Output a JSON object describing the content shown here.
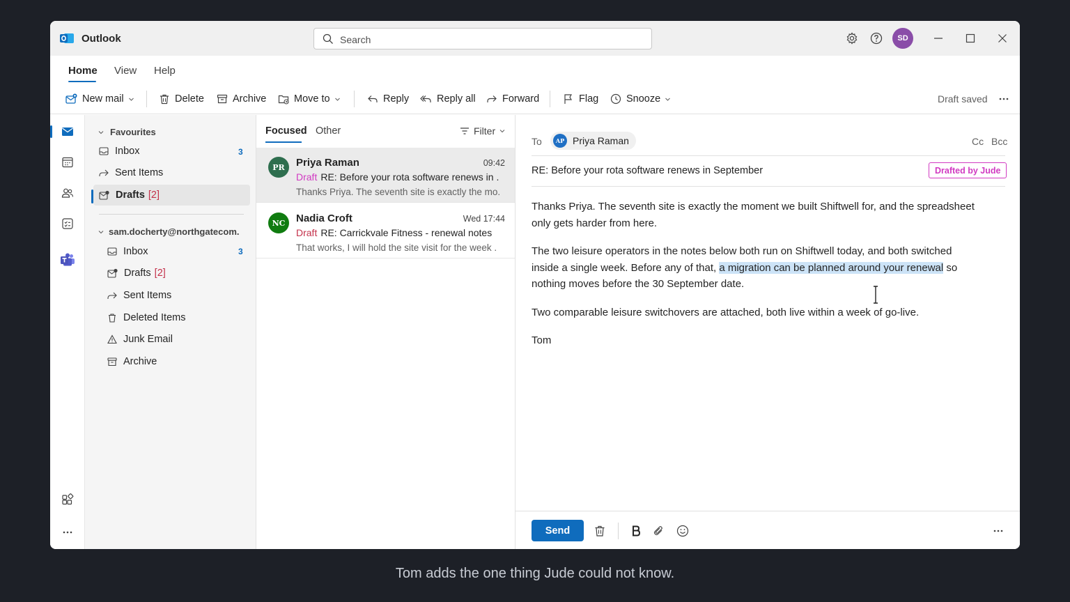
{
  "app": {
    "name": "Outlook"
  },
  "search": {
    "placeholder": "Search"
  },
  "titlebar": {
    "avatar_initials": "SD"
  },
  "ribbon_tabs": [
    "Home",
    "View",
    "Help"
  ],
  "ribbon": {
    "new_mail": "New mail",
    "delete": "Delete",
    "archive": "Archive",
    "move_to": "Move to",
    "reply": "Reply",
    "reply_all": "Reply all",
    "forward": "Forward",
    "flag": "Flag",
    "snooze": "Snooze",
    "status": "Draft saved"
  },
  "folders": {
    "favourites_label": "Favourites",
    "favourites": [
      {
        "label": "Inbox",
        "count": "3"
      },
      {
        "label": "Sent Items"
      },
      {
        "label": "Drafts",
        "count": "[2]"
      }
    ],
    "account_label": "sam.docherty@northgatecom.",
    "account": [
      {
        "label": "Inbox",
        "count": "3"
      },
      {
        "label": "Drafts",
        "count": "[2]"
      },
      {
        "label": "Sent Items"
      },
      {
        "label": "Deleted Items"
      },
      {
        "label": "Junk Email"
      },
      {
        "label": "Archive"
      }
    ]
  },
  "list": {
    "tabs": [
      "Focused",
      "Other"
    ],
    "filter": "Filter",
    "messages": [
      {
        "initials": "PR",
        "sender": "Priya Raman",
        "time": "09:42",
        "draft": "Draft",
        "subject": "RE: Before your rota software renews in .",
        "preview": "Thanks Priya. The seventh site is exactly the mo.",
        "avatar_color": "#2e6e4e"
      },
      {
        "initials": "NC",
        "sender": "Nadia Croft",
        "time": "Wed 17:44",
        "draft": "Draft",
        "subject": "RE: Carrickvale Fitness - renewal notes",
        "preview": "That works, I will hold the site visit for the week .",
        "avatar_color": "#107c10"
      }
    ]
  },
  "reading": {
    "to_label": "To",
    "recipient_initials": "AP",
    "recipient": "Priya Raman",
    "cc": "Cc",
    "bcc": "Bcc",
    "subject": "RE: Before your rota software renews in September",
    "drafted_tag": "Drafted by Jude",
    "para1": "Thanks Priya. The seventh site is exactly the moment we built Shiftwell for, and the spreadsheet only gets harder from here.",
    "para2_before": "The two leisure operators in the notes below both run on Shiftwell today, and both switched inside a single week. Before any of that, ",
    "para2_highlight": "a migration can be planned around your renewal",
    "para2_after": " so nothing moves before the 30 September date.",
    "para3": "Two comparable leisure switchovers are attached, both live within a week of go-live.",
    "signoff": "Tom",
    "send": "Send"
  },
  "caption": "Tom adds the one thing Jude could not know.",
  "colors": {
    "accent": "#0f6cbd",
    "draft_pink": "#d13ac2",
    "count_red": "#c4314b"
  }
}
